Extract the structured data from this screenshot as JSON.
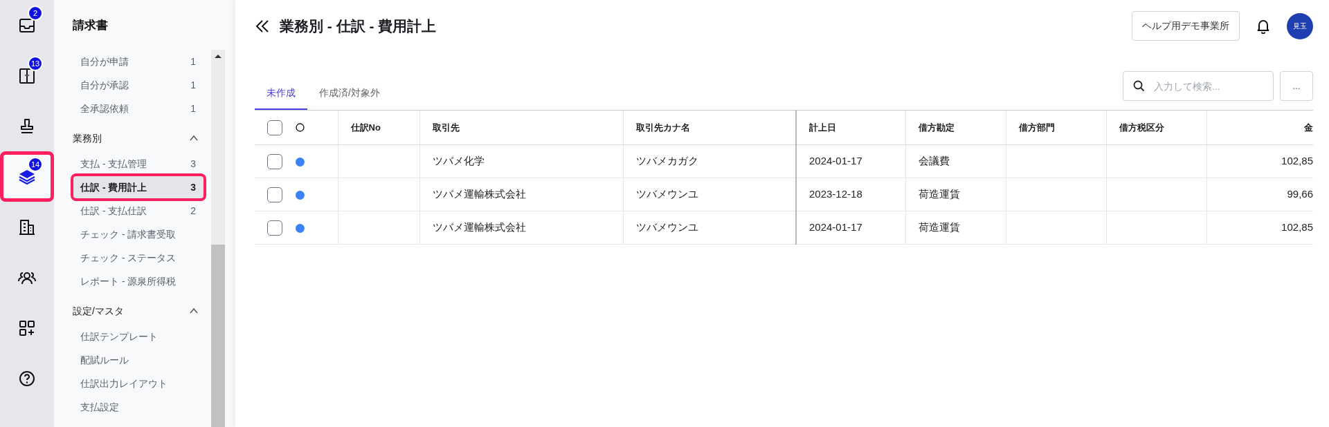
{
  "rail": [
    {
      "kind": "inbox",
      "badge": "2",
      "selected": false
    },
    {
      "kind": "panel",
      "badge": "13",
      "selected": false
    },
    {
      "kind": "stamp",
      "selected": false
    },
    {
      "kind": "layers",
      "badge": "14",
      "selected": true
    },
    {
      "kind": "building",
      "selected": false
    },
    {
      "kind": "people",
      "selected": false
    },
    {
      "kind": "apps",
      "selected": false
    },
    {
      "kind": "help",
      "selected": false
    }
  ],
  "sidebar": {
    "title": "請求書",
    "sections": [
      {
        "items": [
          {
            "label": "自分が申請",
            "count": "1",
            "selected": false
          },
          {
            "label": "自分が承認",
            "count": "1",
            "selected": false
          },
          {
            "label": "全承認依頼",
            "count": "1",
            "selected": false
          }
        ]
      },
      {
        "heading": "業務別",
        "expanded": true,
        "items": [
          {
            "label": "支払 - 支払管理",
            "count": "3",
            "selected": false
          },
          {
            "label": "仕訳 - 費用計上",
            "count": "3",
            "selected": true
          },
          {
            "label": "仕訳 - 支払仕訳",
            "count": "2",
            "selected": false
          },
          {
            "label": "チェック - 請求書受取",
            "selected": false
          },
          {
            "label": "チェック - ステータス",
            "selected": false
          },
          {
            "label": "レポート - 源泉所得税",
            "selected": false
          }
        ]
      },
      {
        "heading": "設定/マスタ",
        "expanded": true,
        "items": [
          {
            "label": "仕訳テンプレート",
            "selected": false
          },
          {
            "label": "配賦ルール",
            "selected": false
          },
          {
            "label": "仕訳出力レイアウト",
            "selected": false
          },
          {
            "label": "支払設定",
            "selected": false
          }
        ]
      }
    ]
  },
  "header": {
    "title": "業務別 - 仕訳 - 費用計上",
    "office_button": "ヘルプ用デモ事業所",
    "avatar": "見玉"
  },
  "tabs": [
    {
      "label": "未作成",
      "selected": true
    },
    {
      "label": "作成済/対象外",
      "selected": false
    }
  ],
  "search": {
    "placeholder": "入力して検索..."
  },
  "more_button": "...",
  "table": {
    "select_all_checked": false,
    "columns": [
      "仕訳No",
      "取引先",
      "取引先カナ名",
      "計上日",
      "借方勘定",
      "借方部門",
      "借方税区分",
      "金"
    ],
    "rows": [
      {
        "checked": false,
        "marked": true,
        "partner": "ツバメ化学",
        "partner_kana": "ツバメカガク",
        "date": "2024-01-17",
        "debit_account": "会議費",
        "amount": "102,85"
      },
      {
        "checked": false,
        "marked": true,
        "partner": "ツバメ運輸株式会社",
        "partner_kana": "ツバメウンユ",
        "date": "2023-12-18",
        "debit_account": "荷造運賃",
        "amount": "99,66"
      },
      {
        "checked": false,
        "marked": true,
        "partner": "ツバメ運輸株式会社",
        "partner_kana": "ツバメウンユ",
        "date": "2024-01-17",
        "debit_account": "荷造運賃",
        "amount": "102,85"
      }
    ]
  }
}
